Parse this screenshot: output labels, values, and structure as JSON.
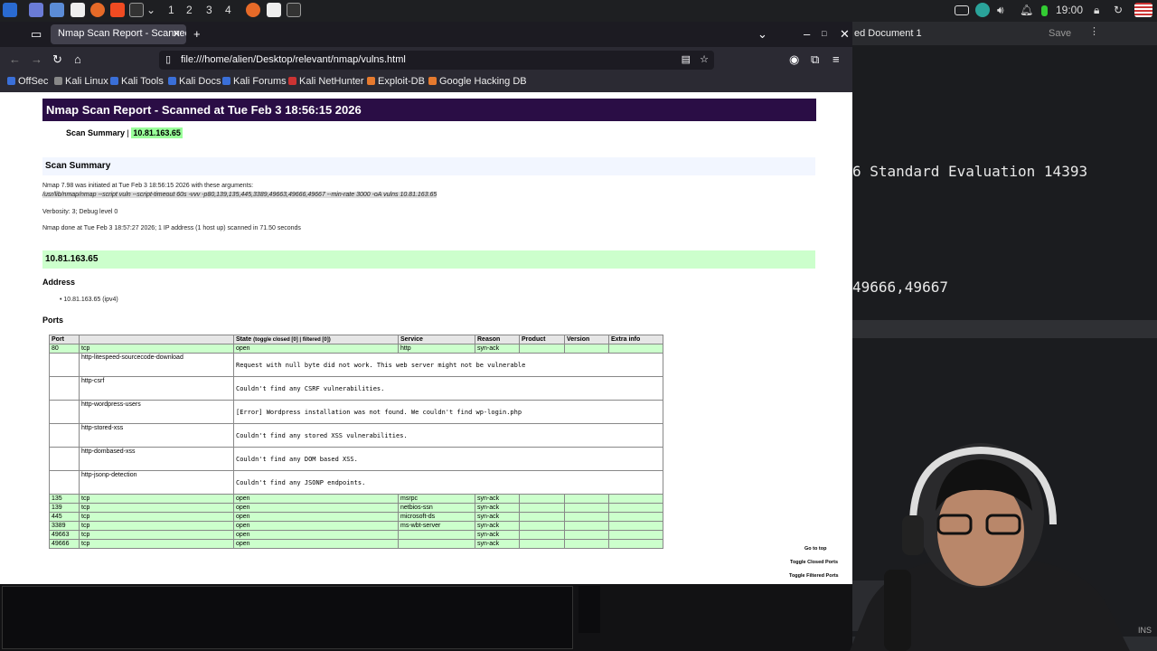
{
  "panel": {
    "workspaces": [
      "1",
      "2",
      "3",
      "4"
    ],
    "clock": "19:00"
  },
  "bgdoc": {
    "title": "ed Document 1",
    "save": "Save",
    "line1": "6 Standard Evaluation 14393",
    "line2": "49666,49667",
    "status": "INS"
  },
  "browser": {
    "tab_title": "Nmap Scan Report - Scanned",
    "url": "file:///home/alien/Desktop/relevant/nmap/vulns.html",
    "bookmarks": [
      "OffSec",
      "Kali Linux",
      "Kali Tools",
      "Kali Docs",
      "Kali Forums",
      "Kali NetHunter",
      "Exploit-DB",
      "Google Hacking DB"
    ]
  },
  "report": {
    "title": "Nmap Scan Report - Scanned at Tue Feb 3 18:56:15 2026",
    "summary_link_label": "Scan Summary",
    "summary_link_sep": " | ",
    "summary_link_ip": "10.81.163.65",
    "section_title": "Scan Summary",
    "initiated": "Nmap 7.98 was initiated at Tue Feb 3 18:56:15 2026 with these arguments:",
    "command": "/usr/lib/nmap/nmap --script vuln --script-timeout 60s -vvv -p80,139,135,445,3389,49663,49666,49667 --min-rate 3000 -oA vulns 10.81.163.65",
    "verbosity": "Verbosity: 3; Debug level 0",
    "done": "Nmap done at Tue Feb 3 18:57:27 2026; 1 IP address (1 host up) scanned in 71.50 seconds",
    "host_header": "10.81.163.65",
    "address_title": "Address",
    "address_item": "10.81.163.65 (ipv4)",
    "ports_title": "Ports",
    "headers": {
      "port": "Port",
      "state": "State",
      "state_note": "(toggle closed [0] | filtered [0])",
      "service": "Service",
      "reason": "Reason",
      "product": "Product",
      "version": "Version",
      "extra": "Extra info"
    },
    "port80": {
      "port": "80",
      "proto": "tcp",
      "state": "open",
      "service": "http",
      "reason": "syn-ack"
    },
    "scripts": [
      {
        "name": "http-litespeed-sourcecode-download",
        "output": "Request with null byte did not work. This web server might not be vulnerable"
      },
      {
        "name": "http-csrf",
        "output": "Couldn't find any CSRF vulnerabilities."
      },
      {
        "name": "http-wordpress-users",
        "output": "[Error] Wordpress installation was not found. We couldn't find wp-login.php"
      },
      {
        "name": "http-stored-xss",
        "output": "Couldn't find any stored XSS vulnerabilities."
      },
      {
        "name": "http-dombased-xss",
        "output": "Couldn't find any DOM based XSS."
      },
      {
        "name": "http-jsonp-detection",
        "output": "Couldn't find any JSONP endpoints."
      }
    ],
    "ports": [
      {
        "port": "135",
        "proto": "tcp",
        "state": "open",
        "service": "msrpc",
        "reason": "syn-ack"
      },
      {
        "port": "139",
        "proto": "tcp",
        "state": "open",
        "service": "netbios-ssn",
        "reason": "syn-ack"
      },
      {
        "port": "445",
        "proto": "tcp",
        "state": "open",
        "service": "microsoft-ds",
        "reason": "syn-ack"
      },
      {
        "port": "3389",
        "proto": "tcp",
        "state": "open",
        "service": "ms-wbt-server",
        "reason": "syn-ack"
      },
      {
        "port": "49663",
        "proto": "tcp",
        "state": "open",
        "service": "",
        "reason": "syn-ack"
      },
      {
        "port": "49666",
        "proto": "tcp",
        "state": "open",
        "service": "",
        "reason": "syn-ack"
      }
    ],
    "side_links": [
      "Go to top",
      "Toggle Closed Ports",
      "Toggle Filtered Ports"
    ]
  }
}
